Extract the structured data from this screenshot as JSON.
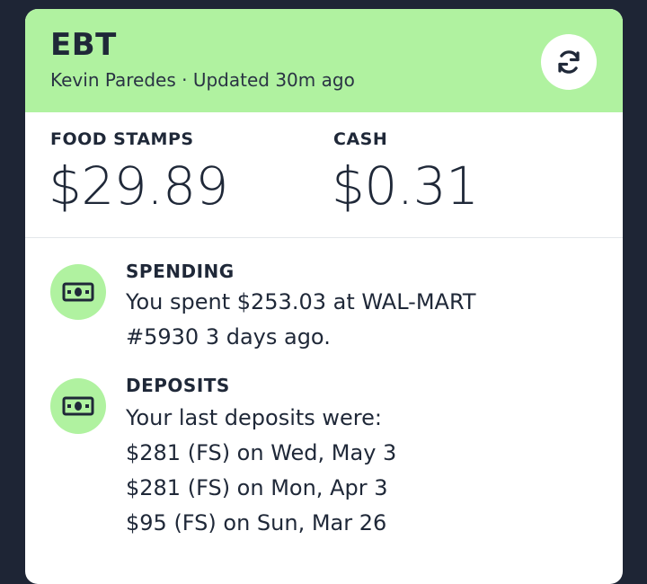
{
  "header": {
    "title": "EBT",
    "subtitle": "Kevin Paredes · Updated 30m ago",
    "refresh_icon": "refresh-icon"
  },
  "balances": {
    "food_stamps": {
      "label": "FOOD STAMPS",
      "value": "$29.89"
    },
    "cash": {
      "label": "CASH",
      "value": "$0.31"
    }
  },
  "spending": {
    "icon": "cash-icon",
    "label": "SPENDING",
    "lines": [
      "You spent $253.03 at WAL-MART",
      "#5930 3 days ago."
    ]
  },
  "deposits": {
    "icon": "cash-icon",
    "label": "DEPOSITS",
    "lines": [
      "Your last deposits were:",
      "$281 (FS) on Wed, May 3",
      "$281 (FS) on Mon, Apr 3",
      "$95 (FS) on Sun, Mar 26"
    ]
  },
  "colors": {
    "page_bg": "#1e2535",
    "accent_green": "#b0f2a0",
    "text_dark": "#1f2838"
  }
}
